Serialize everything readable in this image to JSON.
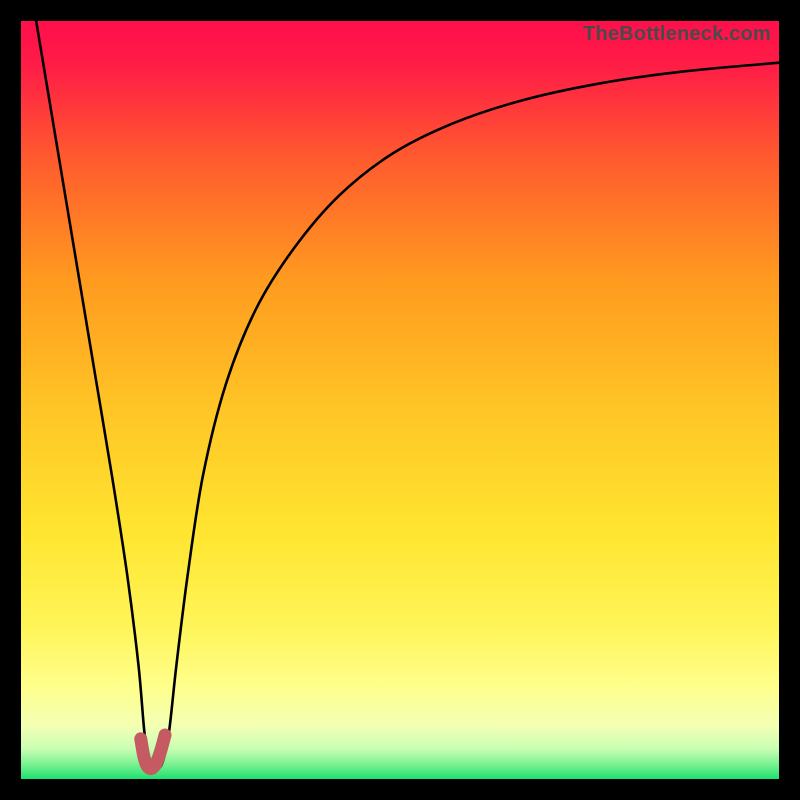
{
  "watermark": "TheBottleneck.com",
  "chart_data": {
    "type": "line",
    "title": "",
    "xlabel": "",
    "ylabel": "",
    "xlim": [
      0,
      100
    ],
    "ylim": [
      0,
      100
    ],
    "background_gradient": {
      "top": "#ff0f4b",
      "mid_upper": "#ff9a1f",
      "mid": "#ffe631",
      "mid_lower": "#ffff8e",
      "bottom": "#1fe06f"
    },
    "series": [
      {
        "name": "bottleneck-curve",
        "color": "#000000",
        "x": [
          2,
          4,
          6,
          8,
          10,
          12,
          14,
          15.5,
          16.3,
          17,
          17.8,
          18.6,
          19.5,
          20.5,
          22,
          24,
          27,
          31,
          36,
          42,
          49,
          57,
          66,
          76,
          87,
          100
        ],
        "values": [
          100,
          88,
          76,
          64,
          52,
          40,
          27,
          15,
          6,
          2,
          1.5,
          2,
          6,
          15,
          27,
          40,
          52,
          62,
          70,
          77,
          82.5,
          86.5,
          89.5,
          91.7,
          93.3,
          94.5
        ]
      },
      {
        "name": "highlight-region",
        "color": "#c65a63",
        "type": "area",
        "x": [
          15.8,
          16.2,
          16.6,
          17.0,
          17.4,
          17.8,
          18.2,
          18.6,
          19.0
        ],
        "values": [
          5.3,
          3.0,
          1.8,
          1.4,
          1.5,
          2.0,
          3.0,
          4.3,
          5.8
        ]
      }
    ],
    "annotations": []
  }
}
